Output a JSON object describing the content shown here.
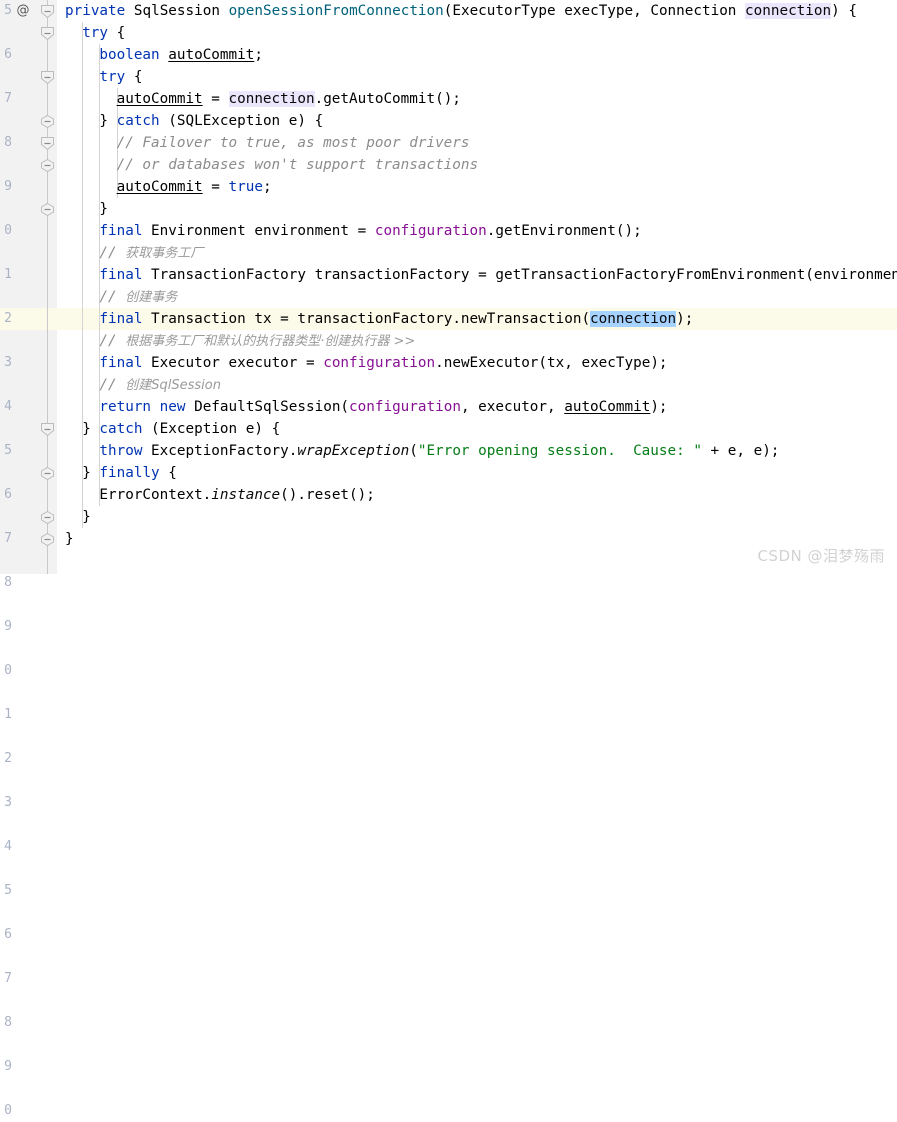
{
  "editor": {
    "language": "java",
    "theme": "IntelliJ Light",
    "line_height_px": 22,
    "font_size_px": 14.3,
    "caret_line_index": 14,
    "colors": {
      "background": "#ffffff",
      "gutter_background": "#f2f2f2",
      "line_number": "#aab3c4",
      "current_line_highlight": "#fcfae8",
      "keyword": "#0033b3",
      "method": "#00627a",
      "field": "#871094",
      "string": "#067d17",
      "comment": "#8c8c8c",
      "comment_cjk": "#9a9a9a",
      "identifier": "#000000",
      "usage_highlight": "#ebe6fc",
      "selection_highlight": "#a6d2ff",
      "indent_guide": "#d4d4d4",
      "fold_line": "#c9c9c9",
      "watermark": "#d2d2d2"
    }
  },
  "gutter": {
    "annotation_marker": "@",
    "line_numbers": [
      "5",
      "6",
      "7",
      "8",
      "9",
      "0",
      "1",
      "2",
      "3",
      "4",
      "5",
      "6",
      "7",
      "8",
      "9",
      "0",
      "1",
      "2",
      "3",
      "4",
      "5",
      "6",
      "7",
      "8",
      "9",
      "0"
    ],
    "fold_markers": [
      {
        "line": 0,
        "type": "region-start"
      },
      {
        "line": 1,
        "type": "region-start"
      },
      {
        "line": 3,
        "type": "region-start"
      },
      {
        "line": 5,
        "type": "region-end"
      },
      {
        "line": 6,
        "type": "region-start"
      },
      {
        "line": 7,
        "type": "region-end"
      },
      {
        "line": 9,
        "type": "region-end"
      },
      {
        "line": 19,
        "type": "region-start"
      },
      {
        "line": 21,
        "type": "region-end"
      },
      {
        "line": 23,
        "type": "region-end"
      },
      {
        "line": 24,
        "type": "region-end"
      }
    ]
  },
  "code": {
    "lines": [
      {
        "indent": 0,
        "tokens": [
          {
            "t": "private",
            "c": "kw"
          },
          {
            "t": " ",
            "c": "punc"
          },
          {
            "t": "SqlSession",
            "c": "typ"
          },
          {
            "t": " ",
            "c": "punc"
          },
          {
            "t": "openSessionFromConnection",
            "c": "mth"
          },
          {
            "t": "(",
            "c": "punc"
          },
          {
            "t": "ExecutorType",
            "c": "typ"
          },
          {
            "t": " execType, ",
            "c": "punc"
          },
          {
            "t": "Connection",
            "c": "typ"
          },
          {
            "t": " ",
            "c": "punc"
          },
          {
            "t": "connection",
            "c": "usage"
          },
          {
            "t": ") {",
            "c": "punc"
          }
        ]
      },
      {
        "indent": 1,
        "tokens": [
          {
            "t": "try",
            "c": "kw"
          },
          {
            "t": " {",
            "c": "punc"
          }
        ]
      },
      {
        "indent": 2,
        "tokens": [
          {
            "t": "boolean",
            "c": "kw"
          },
          {
            "t": " ",
            "c": "punc"
          },
          {
            "t": "autoCommit",
            "c": "lvar"
          },
          {
            "t": ";",
            "c": "punc"
          }
        ]
      },
      {
        "indent": 2,
        "tokens": [
          {
            "t": "try",
            "c": "kw"
          },
          {
            "t": " {",
            "c": "punc"
          }
        ]
      },
      {
        "indent": 3,
        "tokens": [
          {
            "t": "autoCommit",
            "c": "lvar"
          },
          {
            "t": " = ",
            "c": "punc"
          },
          {
            "t": "connection",
            "c": "usage"
          },
          {
            "t": ".",
            "c": "punc"
          },
          {
            "t": "getAutoCommit",
            "c": "mth-dark"
          },
          {
            "t": "();",
            "c": "punc"
          }
        ]
      },
      {
        "indent": 2,
        "tokens": [
          {
            "t": "} ",
            "c": "punc"
          },
          {
            "t": "catch",
            "c": "kw"
          },
          {
            "t": " (",
            "c": "punc"
          },
          {
            "t": "SQLException",
            "c": "typ"
          },
          {
            "t": " e) {",
            "c": "punc"
          }
        ]
      },
      {
        "indent": 3,
        "tokens": [
          {
            "t": "// Failover to true, as most poor drivers",
            "c": "cmt"
          }
        ]
      },
      {
        "indent": 3,
        "tokens": [
          {
            "t": "// or databases won't support transactions",
            "c": "cmt"
          }
        ]
      },
      {
        "indent": 3,
        "tokens": [
          {
            "t": "autoCommit",
            "c": "lvar"
          },
          {
            "t": " = ",
            "c": "punc"
          },
          {
            "t": "true",
            "c": "kw"
          },
          {
            "t": ";",
            "c": "punc"
          }
        ]
      },
      {
        "indent": 2,
        "tokens": [
          {
            "t": "}",
            "c": "punc"
          }
        ]
      },
      {
        "indent": 2,
        "tokens": [
          {
            "t": "final",
            "c": "kw"
          },
          {
            "t": " ",
            "c": "punc"
          },
          {
            "t": "Environment",
            "c": "typ"
          },
          {
            "t": " environment = ",
            "c": "punc"
          },
          {
            "t": "configuration",
            "c": "fld"
          },
          {
            "t": ".",
            "c": "punc"
          },
          {
            "t": "getEnvironment",
            "c": "mth-dark"
          },
          {
            "t": "();",
            "c": "punc"
          }
        ]
      },
      {
        "indent": 2,
        "tokens": [
          {
            "t": "// ",
            "c": "cmt"
          },
          {
            "t": "获取事务工厂",
            "c": "cmt-cn"
          }
        ]
      },
      {
        "indent": 2,
        "tokens": [
          {
            "t": "final",
            "c": "kw"
          },
          {
            "t": " ",
            "c": "punc"
          },
          {
            "t": "TransactionFactory",
            "c": "typ"
          },
          {
            "t": " transactionFactory = ",
            "c": "punc"
          },
          {
            "t": "getTransactionFactoryFromEnvironment",
            "c": "mth-dark"
          },
          {
            "t": "(environment);",
            "c": "punc"
          }
        ]
      },
      {
        "indent": 2,
        "tokens": [
          {
            "t": "// ",
            "c": "cmt"
          },
          {
            "t": "创建事务",
            "c": "cmt-cn"
          }
        ]
      },
      {
        "indent": 2,
        "tokens": [
          {
            "t": "final",
            "c": "kw"
          },
          {
            "t": " ",
            "c": "punc"
          },
          {
            "t": "Transaction",
            "c": "typ"
          },
          {
            "t": " tx = transactionFactory.",
            "c": "punc"
          },
          {
            "t": "newTransaction",
            "c": "mth-dark"
          },
          {
            "t": "(",
            "c": "punc"
          },
          {
            "t": "connection",
            "c": "sel"
          },
          {
            "t": ");",
            "c": "punc"
          }
        ]
      },
      {
        "indent": 2,
        "tokens": [
          {
            "t": "// ",
            "c": "cmt"
          },
          {
            "t": "根据事务工厂和默认的执行器类型·创建执行器 >>",
            "c": "cmt-cn"
          }
        ]
      },
      {
        "indent": 2,
        "tokens": [
          {
            "t": "final",
            "c": "kw"
          },
          {
            "t": " ",
            "c": "punc"
          },
          {
            "t": "Executor",
            "c": "typ"
          },
          {
            "t": " executor = ",
            "c": "punc"
          },
          {
            "t": "configuration",
            "c": "fld"
          },
          {
            "t": ".",
            "c": "punc"
          },
          {
            "t": "newExecutor",
            "c": "mth-dark"
          },
          {
            "t": "(tx, execType);",
            "c": "punc"
          }
        ]
      },
      {
        "indent": 2,
        "tokens": [
          {
            "t": "// ",
            "c": "cmt"
          },
          {
            "t": "创建SqlSession",
            "c": "cmt-cn"
          }
        ]
      },
      {
        "indent": 2,
        "tokens": [
          {
            "t": "return",
            "c": "kw"
          },
          {
            "t": " ",
            "c": "punc"
          },
          {
            "t": "new",
            "c": "kw"
          },
          {
            "t": " ",
            "c": "punc"
          },
          {
            "t": "DefaultSqlSession",
            "c": "typ"
          },
          {
            "t": "(",
            "c": "punc"
          },
          {
            "t": "configuration",
            "c": "fld"
          },
          {
            "t": ", executor, ",
            "c": "punc"
          },
          {
            "t": "autoCommit",
            "c": "lvar"
          },
          {
            "t": ");",
            "c": "punc"
          }
        ]
      },
      {
        "indent": 1,
        "tokens": [
          {
            "t": "} ",
            "c": "punc"
          },
          {
            "t": "catch",
            "c": "kw"
          },
          {
            "t": " (",
            "c": "punc"
          },
          {
            "t": "Exception",
            "c": "typ"
          },
          {
            "t": " e) {",
            "c": "punc"
          }
        ]
      },
      {
        "indent": 2,
        "tokens": [
          {
            "t": "throw",
            "c": "kw"
          },
          {
            "t": " ExceptionFactory.",
            "c": "punc"
          },
          {
            "t": "wrapException",
            "c": "stat"
          },
          {
            "t": "(",
            "c": "punc"
          },
          {
            "t": "\"Error opening session.  Cause: \"",
            "c": "str"
          },
          {
            "t": " + e, e);",
            "c": "punc"
          }
        ]
      },
      {
        "indent": 1,
        "tokens": [
          {
            "t": "} ",
            "c": "punc"
          },
          {
            "t": "finally",
            "c": "kw"
          },
          {
            "t": " {",
            "c": "punc"
          }
        ]
      },
      {
        "indent": 2,
        "tokens": [
          {
            "t": "ErrorContext.",
            "c": "punc"
          },
          {
            "t": "instance",
            "c": "stat"
          },
          {
            "t": "().",
            "c": "punc"
          },
          {
            "t": "reset",
            "c": "mth-dark"
          },
          {
            "t": "();",
            "c": "punc"
          }
        ]
      },
      {
        "indent": 1,
        "tokens": [
          {
            "t": "}",
            "c": "punc"
          }
        ]
      },
      {
        "indent": 0,
        "tokens": [
          {
            "t": "}",
            "c": "punc"
          }
        ]
      },
      {
        "indent": 0,
        "tokens": []
      }
    ]
  },
  "watermark": {
    "text": "CSDN @泪梦殇雨"
  }
}
